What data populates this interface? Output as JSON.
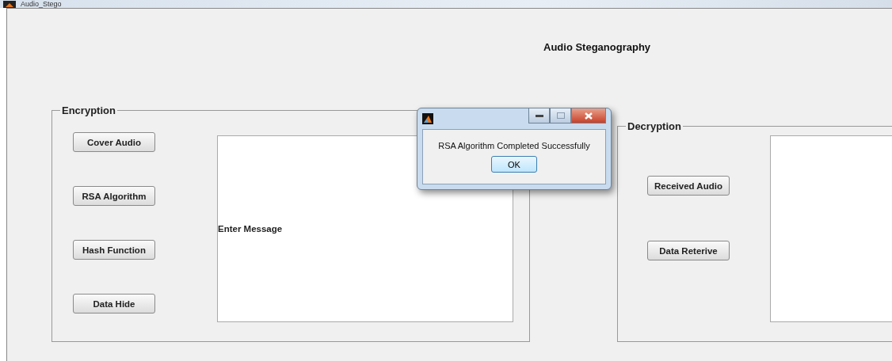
{
  "window": {
    "title": "Audio_Stego"
  },
  "heading": "Audio Steganography",
  "encryption": {
    "title": "Encryption",
    "buttons": [
      "Cover Audio",
      "RSA Algorithm",
      "Hash Function",
      "Data Hide"
    ],
    "message": {
      "value": "Enter Message"
    }
  },
  "decryption": {
    "title": "Decryption",
    "buttons": [
      "Received Audio",
      "Data Reterive"
    ]
  },
  "dialog": {
    "message": "RSA Algorithm Completed Successfully",
    "button": "OK"
  }
}
